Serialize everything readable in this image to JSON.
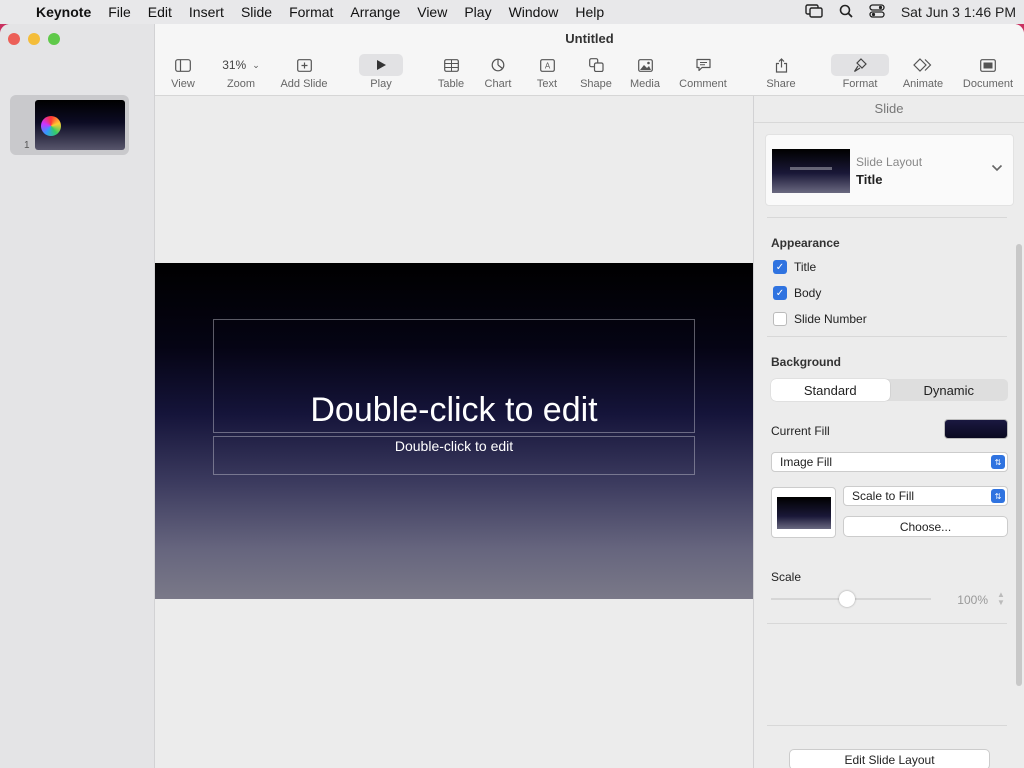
{
  "menubar": {
    "app": "Keynote",
    "items": [
      "File",
      "Edit",
      "Insert",
      "Slide",
      "Format",
      "Arrange",
      "View",
      "Play",
      "Window",
      "Help"
    ],
    "datetime": "Sat Jun 3  1:46 PM"
  },
  "window": {
    "title": "Untitled"
  },
  "toolbar": {
    "view": "View",
    "zoom_value": "31%",
    "zoom": "Zoom",
    "add_slide": "Add Slide",
    "play": "Play",
    "table": "Table",
    "chart": "Chart",
    "text": "Text",
    "shape": "Shape",
    "media": "Media",
    "comment": "Comment",
    "share": "Share",
    "format": "Format",
    "animate": "Animate",
    "document": "Document"
  },
  "navigator": {
    "slide_number": "1"
  },
  "slide": {
    "title_placeholder": "Double-click to edit",
    "body_placeholder": "Double-click to edit"
  },
  "inspector": {
    "header": "Slide",
    "layout_label": "Slide Layout",
    "layout_value": "Title",
    "appearance": {
      "title": "Appearance",
      "title_cb": "Title",
      "body_cb": "Body",
      "slide_number_cb": "Slide Number"
    },
    "background": {
      "title": "Background",
      "standard": "Standard",
      "dynamic": "Dynamic",
      "current_fill": "Current Fill",
      "fill_type": "Image Fill",
      "scale_mode": "Scale to Fill",
      "choose": "Choose...",
      "scale_label": "Scale",
      "scale_value": "100%"
    },
    "edit_layout": "Edit Slide Layout"
  }
}
